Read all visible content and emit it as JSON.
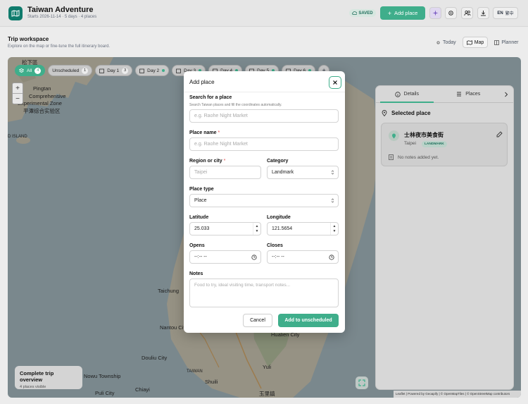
{
  "header": {
    "title": "Taiwan Adventure",
    "subtitle": "Starts 2026-11-14 · 5 days · 4 places",
    "saved_label": "SAVED",
    "add_place_label": "Add place",
    "lang_label": "EN",
    "lang_alt": "繁中"
  },
  "workspace": {
    "title": "Trip workspace",
    "subtitle": "Explore on the map or fine-tune the full itinerary board.",
    "view_tabs": [
      {
        "label": "Today"
      },
      {
        "label": "Map"
      },
      {
        "label": "Planner"
      }
    ]
  },
  "chips": [
    {
      "label": "All",
      "count": "4"
    },
    {
      "label": "Unscheduled",
      "count": "1"
    },
    {
      "label": "Day 1",
      "count": "3"
    },
    {
      "label": "Day 2",
      "count": ""
    },
    {
      "label": "Day 3",
      "count": ""
    },
    {
      "label": "Day 4",
      "count": ""
    },
    {
      "label": "Day 5",
      "count": ""
    },
    {
      "label": "Day 6",
      "count": ""
    }
  ],
  "map": {
    "labels": {
      "l1": "松下區",
      "l2": "Pingtan",
      "l3": "Comprehensive",
      "l4": "Experimental Zone",
      "l5": "平潭综合实验区",
      "l6": "D ISLAND",
      "l7": "Taichung",
      "l8": "Nantou City",
      "l9": "Douliu City",
      "l10": "Nowu Township",
      "l11": "Puli City",
      "l12": "Chiayi",
      "l13": "TAIWAN",
      "l14": "Shuili",
      "l15": "Hualien City",
      "l16": "Yuli",
      "l17": "玉里鎮"
    },
    "attribution": "Leaflet | Powered by Geoapify | © OpenMapTiles | © OpenStreetMap contributors"
  },
  "overview": {
    "title": "Complete trip overview",
    "subtitle": "4 places visible"
  },
  "side_panel": {
    "tabs": [
      {
        "label": "Details"
      },
      {
        "label": "Places"
      }
    ],
    "selected_title": "Selected place",
    "place": {
      "name": "士林夜市美食街",
      "city": "Taipei",
      "badge": "LANDMARK",
      "notes": "No notes added yet."
    }
  },
  "modal": {
    "title": "Add place",
    "search_label": "Search for a place",
    "search_hint": "Search Taiwan places and fill the coordinates automatically.",
    "search_placeholder": "e.g. Raohe Night Market",
    "name_label": "Place name",
    "name_placeholder": "e.g. Raohe Night Market",
    "region_label": "Region or city",
    "region_placeholder": "Taipei",
    "category_label": "Category",
    "category_value": "Landmark",
    "type_label": "Place type",
    "type_value": "Place",
    "lat_label": "Latitude",
    "lat_value": "25.033",
    "lng_label": "Longitude",
    "lng_value": "121.5654",
    "opens_label": "Opens",
    "closes_label": "Closes",
    "time_placeholder": "--:-- --",
    "notes_label": "Notes",
    "notes_placeholder": "Food to try, ideal visiting time, transport notes...",
    "cancel_label": "Cancel",
    "submit_label": "Add to unscheduled",
    "required_mark": "*"
  },
  "colors": {
    "accent": "#3fae8b",
    "required": "#e24c4c",
    "map_sea": "#a8c0c8",
    "map_land": "#d8d0b8"
  }
}
